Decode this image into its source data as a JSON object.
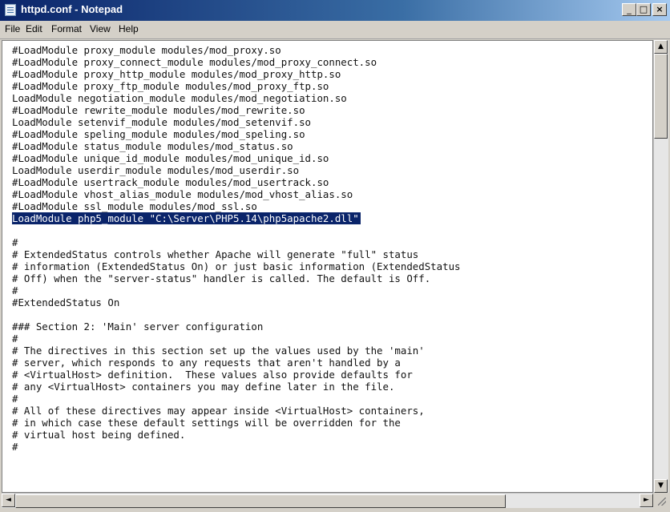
{
  "window": {
    "title": "httpd.conf - Notepad",
    "controls": {
      "minimize": "_",
      "maximize": "□",
      "close": "×"
    }
  },
  "menu": {
    "items": [
      "File",
      "Edit",
      "Format",
      "View",
      "Help"
    ]
  },
  "editor": {
    "selected_line": "LoadModule php5_module \"C:\\Server\\PHP5.14\\php5apache2.dll\"",
    "lines": [
      "#LoadModule proxy_module modules/mod_proxy.so",
      "#LoadModule proxy_connect_module modules/mod_proxy_connect.so",
      "#LoadModule proxy_http_module modules/mod_proxy_http.so",
      "#LoadModule proxy_ftp_module modules/mod_proxy_ftp.so",
      "LoadModule negotiation_module modules/mod_negotiation.so",
      "#LoadModule rewrite_module modules/mod_rewrite.so",
      "LoadModule setenvif_module modules/mod_setenvif.so",
      "#LoadModule speling_module modules/mod_speling.so",
      "#LoadModule status_module modules/mod_status.so",
      "#LoadModule unique_id_module modules/mod_unique_id.so",
      "LoadModule userdir_module modules/mod_userdir.so",
      "#LoadModule usertrack_module modules/mod_usertrack.so",
      "#LoadModule vhost_alias_module modules/mod_vhost_alias.so",
      "#LoadModule ssl_module modules/mod_ssl.so",
      "LoadModule php5_module \"C:\\Server\\PHP5.14\\php5apache2.dll\"",
      "",
      "#",
      "# ExtendedStatus controls whether Apache will generate \"full\" status",
      "# information (ExtendedStatus On) or just basic information (ExtendedStatus",
      "# Off) when the \"server-status\" handler is called. The default is Off.",
      "#",
      "#ExtendedStatus On",
      "",
      "### Section 2: 'Main' server configuration",
      "#",
      "# The directives in this section set up the values used by the 'main'",
      "# server, which responds to any requests that aren't handled by a",
      "# <VirtualHost> definition.  These values also provide defaults for",
      "# any <VirtualHost> containers you may define later in the file.",
      "#",
      "# All of these directives may appear inside <VirtualHost> containers,",
      "# in which case these default settings will be overridden for the",
      "# virtual host being defined.",
      "#"
    ]
  },
  "scrollbars": {
    "up_arrow": "▲",
    "down_arrow": "▼",
    "left_arrow": "◄",
    "right_arrow": "►"
  }
}
